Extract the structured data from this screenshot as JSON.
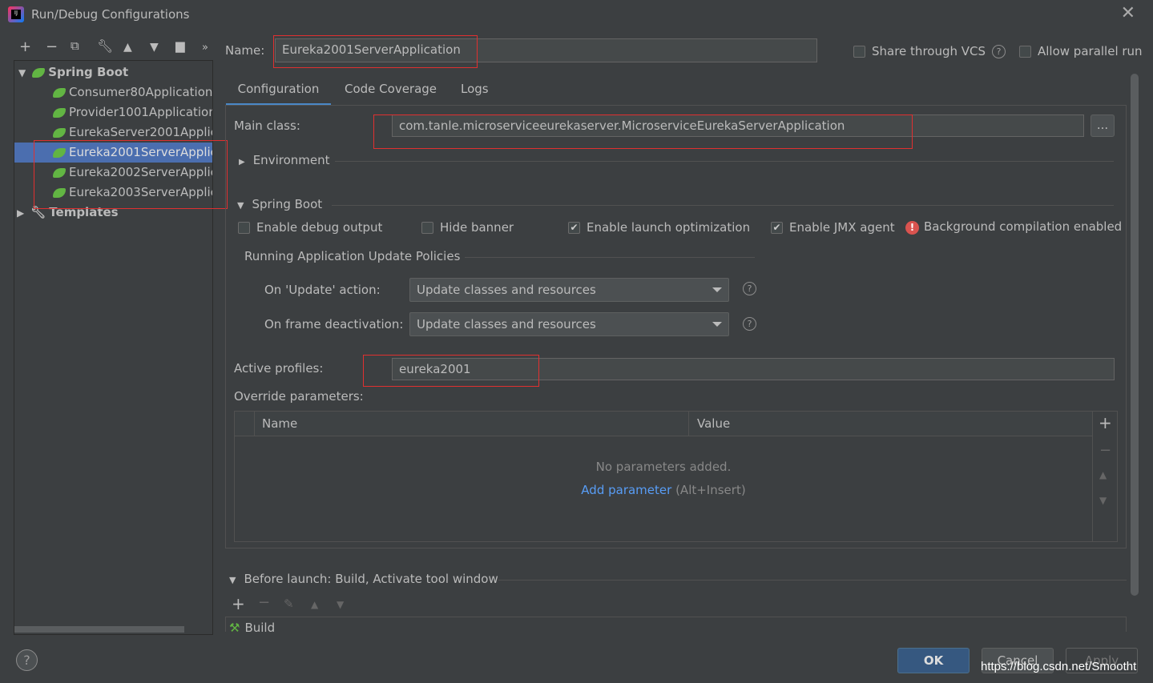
{
  "window": {
    "title": "Run/Debug Configurations",
    "logo_text": "IJ"
  },
  "toolbar": {
    "icons": [
      "plus-icon",
      "minus-icon",
      "copy-icon",
      "wrench-icon",
      "arrow-up-icon",
      "arrow-down-icon",
      "folder-add-icon",
      "more-icon"
    ]
  },
  "tree": {
    "group": "Spring Boot",
    "items": [
      "Consumer80Application",
      "Provider1001Application",
      "EurekaServer2001Applic",
      "Eureka2001ServerApplic",
      "Eureka2002ServerApplic",
      "Eureka2003ServerApplic"
    ],
    "selected_index": 3,
    "templates": "Templates"
  },
  "name_label": "Name:",
  "name_value": "Eureka2001ServerApplication",
  "share_vcs": {
    "label": "Share through VCS",
    "checked": false
  },
  "allow_parallel": {
    "label": "Allow parallel run",
    "checked": false
  },
  "tabs": [
    "Configuration",
    "Code Coverage",
    "Logs"
  ],
  "active_tab": 0,
  "main_class": {
    "label": "Main class:",
    "value": "com.tanle.microserviceeurekaserver.MicroserviceEurekaServerApplication",
    "browse": "..."
  },
  "environment": "Environment",
  "spring_boot": {
    "title": "Spring Boot",
    "options": [
      {
        "label": "Enable debug output",
        "checked": false
      },
      {
        "label": "Hide banner",
        "checked": false
      },
      {
        "label": "Enable launch optimization",
        "checked": true
      },
      {
        "label": "Enable JMX agent",
        "checked": true
      }
    ],
    "warning": "Background compilation enabled"
  },
  "policies": {
    "title": "Running Application Update Policies",
    "update_label": "On 'Update' action:",
    "update_value": "Update classes and resources",
    "frame_label": "On frame deactivation:",
    "frame_value": "Update classes and resources"
  },
  "active_profiles": {
    "label": "Active profiles:",
    "value": "eureka2001"
  },
  "override": {
    "label": "Override parameters:",
    "columns": [
      "Name",
      "Value"
    ],
    "empty": "No parameters added.",
    "add_link": "Add parameter",
    "add_hint": "(Alt+Insert)"
  },
  "before_launch": {
    "title": "Before launch: Build, Activate tool window",
    "items": [
      "Build"
    ]
  },
  "buttons": {
    "ok": "OK",
    "cancel": "Cancel",
    "apply": "Apply",
    "help": "?"
  },
  "watermark": "https://blog.csdn.net/Smootht",
  "colors": {
    "bg": "#3c3f41",
    "selection": "#4b6eaf",
    "accent": "#4a88c7",
    "highlight_box": "#e03030",
    "link": "#589df6"
  }
}
